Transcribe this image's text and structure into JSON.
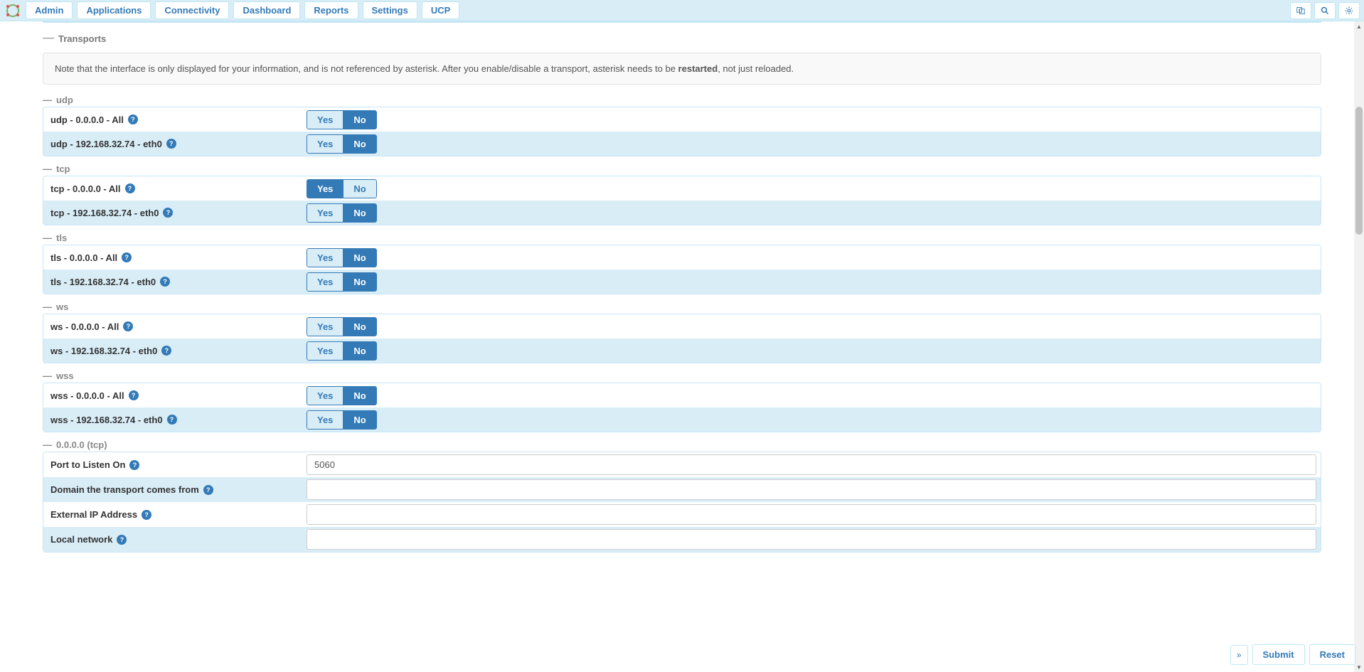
{
  "nav": [
    "Admin",
    "Applications",
    "Connectivity",
    "Dashboard",
    "Reports",
    "Settings",
    "UCP"
  ],
  "transports": {
    "heading": "Transports",
    "note_pre": "Note that the interface is only displayed for your information, and is not referenced by asterisk. After you enable/disable a transport, asterisk needs to be ",
    "note_bold": "restarted",
    "note_post": ", not just reloaded."
  },
  "yes": "Yes",
  "no": "No",
  "groups": [
    {
      "name": "udp",
      "rows": [
        {
          "label": "udp - 0.0.0.0 - All",
          "value": "No"
        },
        {
          "label": "udp - 192.168.32.74 - eth0",
          "value": "No"
        }
      ]
    },
    {
      "name": "tcp",
      "rows": [
        {
          "label": "tcp - 0.0.0.0 - All",
          "value": "Yes"
        },
        {
          "label": "tcp - 192.168.32.74 - eth0",
          "value": "No"
        }
      ]
    },
    {
      "name": "tls",
      "rows": [
        {
          "label": "tls - 0.0.0.0 - All",
          "value": "No"
        },
        {
          "label": "tls - 192.168.32.74 - eth0",
          "value": "No"
        }
      ]
    },
    {
      "name": "ws",
      "rows": [
        {
          "label": "ws - 0.0.0.0 - All",
          "value": "No"
        },
        {
          "label": "ws - 192.168.32.74 - eth0",
          "value": "No"
        }
      ]
    },
    {
      "name": "wss",
      "rows": [
        {
          "label": "wss - 0.0.0.0 - All",
          "value": "No"
        },
        {
          "label": "wss - 192.168.32.74 - eth0",
          "value": "No"
        }
      ]
    }
  ],
  "tcp_section": {
    "heading": "0.0.0.0 (tcp)",
    "fields": [
      {
        "label": "Port to Listen On",
        "value": "5060"
      },
      {
        "label": "Domain the transport comes from",
        "value": ""
      },
      {
        "label": "External IP Address",
        "value": ""
      },
      {
        "label": "Local network",
        "value": ""
      }
    ]
  },
  "footer": {
    "submit": "Submit",
    "reset": "Reset"
  }
}
